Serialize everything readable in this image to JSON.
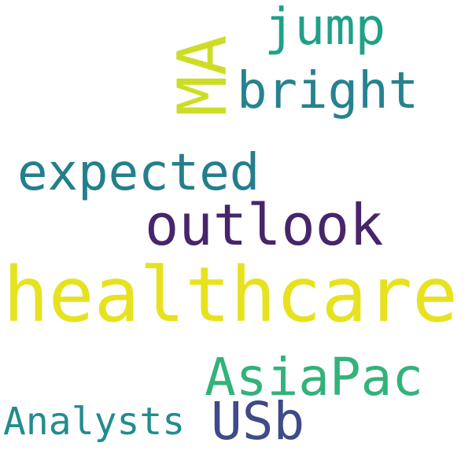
{
  "word_cloud": {
    "words": [
      {
        "text": "healthcare",
        "color": "#e7e21f"
      },
      {
        "text": "outlook",
        "color": "#46256b"
      },
      {
        "text": "expected",
        "color": "#247f8c"
      },
      {
        "text": "bright",
        "color": "#25838e"
      },
      {
        "text": "jump",
        "color": "#1fa187"
      },
      {
        "text": "MA",
        "color": "#cddd26"
      },
      {
        "text": "AsiaPac",
        "color": "#33b279"
      },
      {
        "text": "USb",
        "color": "#3e4a89"
      },
      {
        "text": "Analysts",
        "color": "#228c8d"
      }
    ],
    "background": "#ffffff"
  }
}
